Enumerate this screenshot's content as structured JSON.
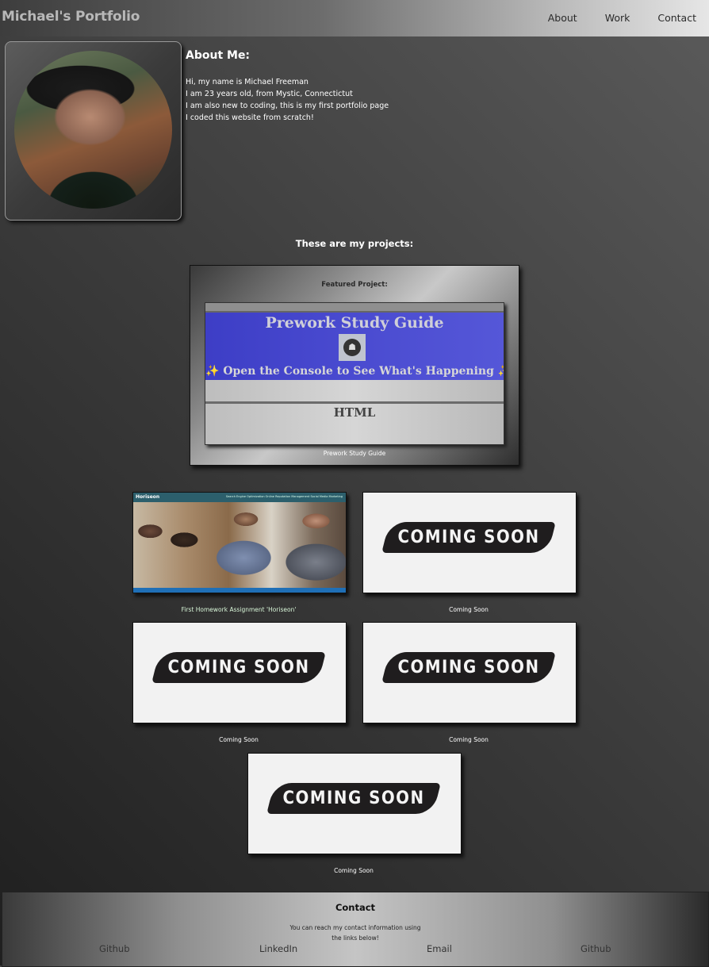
{
  "header": {
    "brand": "Michael's Portfolio",
    "nav": [
      "About",
      "Work",
      "Contact"
    ]
  },
  "about": {
    "title": "About Me:",
    "lines": [
      "Hi, my name is Michael Freeman",
      "I am 23 years old, from Mystic, Connectictut",
      "I am also new to coding, this is my first portfolio page",
      "I coded this website from scratch!"
    ]
  },
  "projects": {
    "title": "These are my projects:",
    "featured": {
      "label": "Featured Project:",
      "screenshot_title": "Prework Study Guide",
      "screenshot_subtitle": "Open the Console to See What's Happening",
      "screenshot_section": "HTML",
      "caption": "Prework Study Guide"
    },
    "cards": [
      {
        "caption": "First Homework Assignment 'Horiseon'",
        "image": "horiseon-screenshot",
        "logo": "Horiseon",
        "links": "Search Engine Optimization   Online Reputation Management   Social Media Marketing"
      },
      {
        "caption": "Coming Soon",
        "image": "coming-soon",
        "text": "COMING SOON"
      },
      {
        "caption": "Coming Soon",
        "image": "coming-soon",
        "text": "COMING SOON"
      },
      {
        "caption": "Coming Soon",
        "image": "coming-soon",
        "text": "COMING SOON"
      },
      {
        "caption": "Coming Soon",
        "image": "coming-soon",
        "text": "COMING SOON"
      }
    ]
  },
  "footer": {
    "title": "Contact",
    "text_line1": "You can reach my contact information using",
    "text_line2": "the links below!",
    "links": [
      "Github",
      "LinkedIn",
      "Email",
      "Github"
    ]
  }
}
